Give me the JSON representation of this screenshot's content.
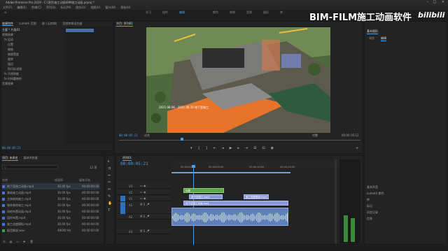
{
  "window": {
    "title": "Adobe Premiere Pro 2019 - C:\\项目\\施工动画\\BIM施工动画.prproj *"
  },
  "menu": [
    "文件(F)",
    "编辑(E)",
    "剪辑(C)",
    "序列(S)",
    "标记(M)",
    "图形(G)",
    "视图(V)",
    "窗口(W)",
    "帮助(H)"
  ],
  "workspaces": [
    "学习",
    "组件",
    "编辑",
    "颜色",
    "效果",
    "音频",
    "图形",
    "库"
  ],
  "watermark": "BIM-FILM施工动画软件",
  "brand_logo": "bilibili",
  "source_panel": {
    "tabs": [
      "效果控件",
      "Lumetri 范围",
      "源: (无剪辑)",
      "音频剪辑混合器"
    ],
    "rows": [
      "主要 * 片段01",
      "视频效果",
      "fx 运动",
      "位置",
      "缩放",
      "缩放宽度",
      "旋转",
      "锚点",
      "防闪烁滤镜",
      "fx 不透明度",
      "fx 时间重映射",
      "音频效果"
    ],
    "timecode": "00:00:05:21"
  },
  "program_monitor": {
    "tabs": [
      "节目: 序列01"
    ],
    "timecode": "00:00:05:21",
    "fit": "适合",
    "quality": "完整",
    "duration": "00:00:16:12",
    "overlay_text": "2021.08.06 - 2021.08.10  地下室施工"
  },
  "project_panel": {
    "tabs": [
      "项目: 未命名",
      "媒体浏览器"
    ],
    "search_placeholder": "",
    "count": "13 项",
    "headers": [
      "名称",
      "帧速率",
      "媒体开始"
    ],
    "items": [
      {
        "name": "地下室施工动画.mp4",
        "rate": "30.00 fps",
        "start": "00:00:00:00"
      },
      {
        "name": "基础施工动画.mp4",
        "rate": "30.00 fps",
        "start": "00:00:00:00"
      },
      {
        "name": "主体结构施工.mp4",
        "rate": "30.00 fps",
        "start": "00:00:00:00"
      },
      {
        "name": "装饰装修施工.mp4",
        "rate": "30.00 fps",
        "start": "00:00:00:00"
      },
      {
        "name": "场地布置动画.mp4",
        "rate": "30.00 fps",
        "start": "00:00:00:00"
      },
      {
        "name": "塔吊布置.mp4",
        "rate": "30.00 fps",
        "start": "00:00:00:00"
      },
      {
        "name": "施工进度模拟.mp4",
        "rate": "30.00 fps",
        "start": "00:00:00:00"
      },
      {
        "name": "配音解说.wav",
        "rate": "48000 Hz",
        "start": "00:00:00:00"
      }
    ]
  },
  "timeline": {
    "tabs": [
      "序列01"
    ],
    "timecode": "00:00:05:21",
    "ruler": [
      "00:00:00:00",
      "00:00:05:00",
      "00:00:10:00",
      "00:00:15:00"
    ],
    "tracks": [
      "V3",
      "V2",
      "V1",
      "A1",
      "A2",
      "A3"
    ],
    "clips": [
      {
        "label": "标题",
        "track": "V3"
      },
      {
        "label": "地下室施工.mp4",
        "track": "V2"
      },
      {
        "label": "地下室施工动画.mp4",
        "track": "V1"
      },
      {
        "label": "施工进度模拟.mp4",
        "track": "V1"
      }
    ]
  },
  "right_panel": {
    "tabs": [
      "基本图形"
    ],
    "subtabs": [
      "浏览",
      "编辑"
    ],
    "items": [
      "基本声音",
      "Lumetri 颜色",
      "库",
      "标记",
      "历史记录",
      "信息"
    ]
  },
  "colors": {
    "accent": "#4a9ee8",
    "panel": "#232323",
    "bg": "#1d1d1d",
    "clip_video": "#5aa64a",
    "clip_audio": "#5f7fb8"
  }
}
